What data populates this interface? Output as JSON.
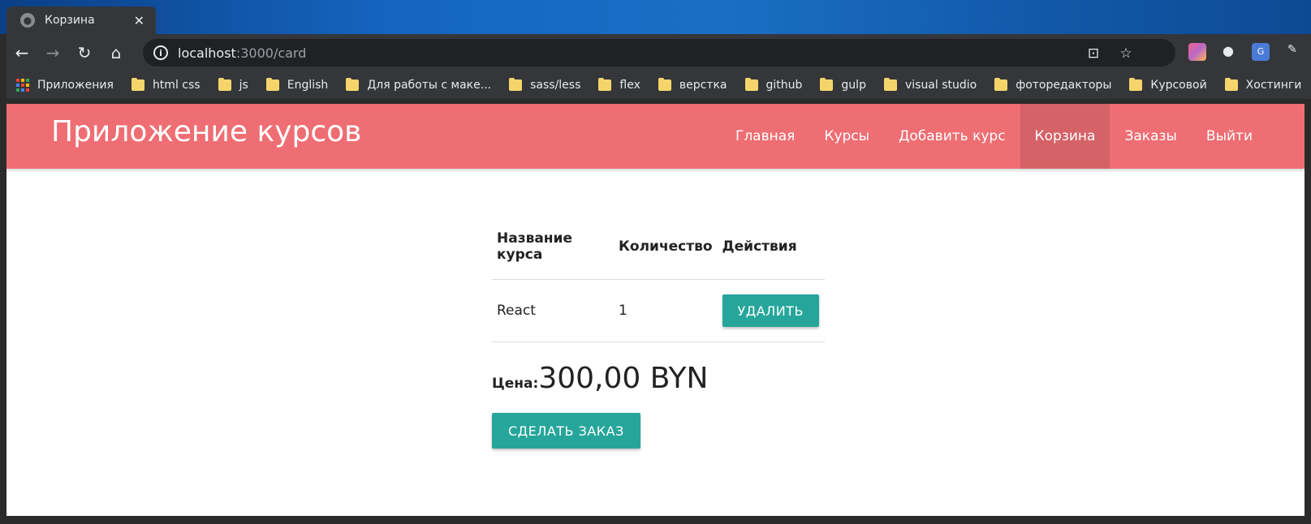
{
  "browser": {
    "tab": {
      "title": "Корзина",
      "close": "✕"
    },
    "url": {
      "host": "localhost",
      "path": ":3000/card"
    },
    "bookmarks": {
      "apps": "Приложения",
      "folders": [
        "html css",
        "js",
        "English",
        "Для работы с маке...",
        "sass/less",
        "flex",
        "верстка",
        "github",
        "gulp",
        "visual studio",
        "фоторедакторы",
        "Курсовой",
        "Хостинги"
      ]
    }
  },
  "navbar": {
    "brand": "Приложение курсов",
    "links": [
      "Главная",
      "Курсы",
      "Добавить курс",
      "Корзина",
      "Заказы",
      "Выйти"
    ],
    "active_index": 3,
    "color": "#ee6e73"
  },
  "cart": {
    "headers": [
      "Название курса",
      "Количество",
      "Действия"
    ],
    "rows": [
      {
        "title": "React",
        "count": "1",
        "action": "УДАЛИТЬ"
      }
    ],
    "price_label": "Цена:",
    "price_value": "300,00 BYN",
    "order_button": "СДЕЛАТЬ ЗАКАЗ",
    "button_color": "#26a69a"
  }
}
